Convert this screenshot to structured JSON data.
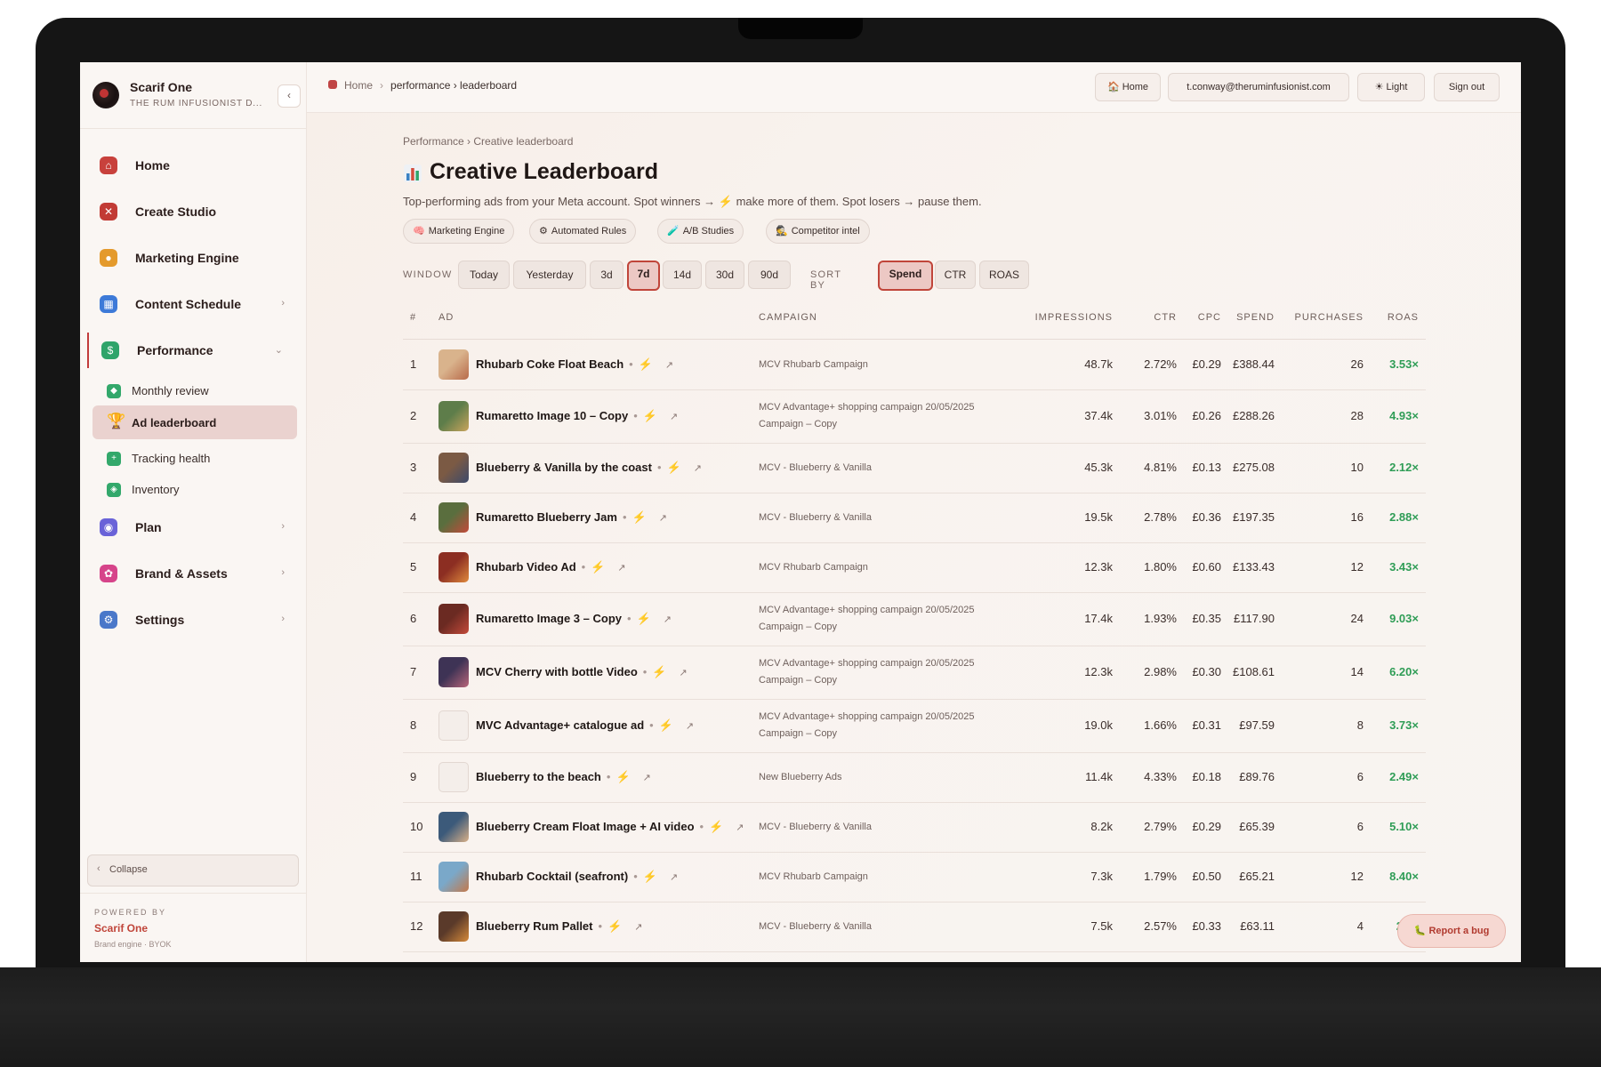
{
  "brand": {
    "name": "Scarif One",
    "subtitle": "THE RUM INFUSIONIST D..."
  },
  "nav": [
    {
      "label": "Home",
      "icon": "home-icon",
      "color": "#c8413c"
    },
    {
      "label": "Create Studio",
      "icon": "tools-icon",
      "color": "#c23b35"
    },
    {
      "label": "Marketing Engine",
      "icon": "brain-icon",
      "color": "#e49a2c"
    },
    {
      "label": "Content Schedule",
      "icon": "calendar-icon",
      "color": "#3d7ad8"
    },
    {
      "label": "Performance",
      "icon": "chart-icon",
      "color": "#2fa46a"
    }
  ],
  "performance_sub": [
    {
      "label": "Monthly review",
      "icon": "review-icon",
      "color": "#33a86b"
    },
    {
      "label": "Ad leaderboard",
      "icon": "trophy-icon",
      "color": "#d9a22b"
    },
    {
      "label": "Tracking health",
      "icon": "health-icon",
      "color": "#33a86b"
    },
    {
      "label": "Inventory",
      "icon": "box-icon",
      "color": "#33a86b"
    }
  ],
  "nav_more": [
    {
      "label": "Plan",
      "icon": "plan-icon",
      "color": "#6a63d8"
    },
    {
      "label": "Brand & Assets",
      "icon": "palette-icon",
      "color": "#d6448a"
    },
    {
      "label": "Settings",
      "icon": "gear-icon",
      "color": "#4a78c9"
    }
  ],
  "collapse_label": "Collapse",
  "powered": {
    "kicker": "POWERED BY",
    "name": "Scarif One",
    "sub": "Brand engine · BYOK"
  },
  "topbar": {
    "crumb_home": "Home",
    "crumb_path": "performance › leaderboard",
    "home_btn": "Home",
    "email": "t.conway@theruminfusionist.com",
    "theme_btn": "Light",
    "signout_btn": "Sign out"
  },
  "page": {
    "crumb": "Performance › Creative leaderboard",
    "title": "Creative Leaderboard",
    "description": "Top-performing ads from your Meta account. Spot winners → ⚡ make more of them. Spot losers → pause them."
  },
  "chips": [
    "Marketing Engine",
    "Automated Rules",
    "A/B Studies",
    "Competitor intel"
  ],
  "window_label": "WINDOW",
  "window_options": [
    "Today",
    "Yesterday",
    "3d",
    "7d",
    "14d",
    "30d",
    "90d"
  ],
  "window_selected": "7d",
  "sort_label": "SORT BY",
  "sort_options": [
    "Spend",
    "CTR",
    "ROAS"
  ],
  "sort_selected": "Spend",
  "columns": [
    "#",
    "AD",
    "CAMPAIGN",
    "IMPRESSIONS",
    "CTR",
    "CPC",
    "SPEND",
    "PURCHASES",
    "ROAS"
  ],
  "rows": [
    {
      "rank": "1",
      "ad": "Rhubarb Coke Float Beach",
      "campaign": "MCV Rhubarb Campaign",
      "impressions": "48.7k",
      "ctr": "2.72%",
      "cpc": "£0.29",
      "spend": "£388.44",
      "purchases": "26",
      "roas": "3.53×"
    },
    {
      "rank": "2",
      "ad": "Rumaretto Image 10 – Copy",
      "campaign": "MCV Advantage+ shopping campaign 20/05/2025 Campaign – Copy",
      "impressions": "37.4k",
      "ctr": "3.01%",
      "cpc": "£0.26",
      "spend": "£288.26",
      "purchases": "28",
      "roas": "4.93×"
    },
    {
      "rank": "3",
      "ad": "Blueberry & Vanilla by the coast",
      "campaign": "MCV - Blueberry & Vanilla",
      "impressions": "45.3k",
      "ctr": "4.81%",
      "cpc": "£0.13",
      "spend": "£275.08",
      "purchases": "10",
      "roas": "2.12×"
    },
    {
      "rank": "4",
      "ad": "Rumaretto Blueberry Jam",
      "campaign": "MCV - Blueberry & Vanilla",
      "impressions": "19.5k",
      "ctr": "2.78%",
      "cpc": "£0.36",
      "spend": "£197.35",
      "purchases": "16",
      "roas": "2.88×"
    },
    {
      "rank": "5",
      "ad": "Rhubarb Video Ad",
      "campaign": "MCV Rhubarb Campaign",
      "impressions": "12.3k",
      "ctr": "1.80%",
      "cpc": "£0.60",
      "spend": "£133.43",
      "purchases": "12",
      "roas": "3.43×"
    },
    {
      "rank": "6",
      "ad": "Rumaretto Image 3 – Copy",
      "campaign": "MCV Advantage+ shopping campaign 20/05/2025 Campaign – Copy",
      "impressions": "17.4k",
      "ctr": "1.93%",
      "cpc": "£0.35",
      "spend": "£117.90",
      "purchases": "24",
      "roas": "9.03×"
    },
    {
      "rank": "7",
      "ad": "MCV Cherry with bottle Video",
      "campaign": "MCV Advantage+ shopping campaign 20/05/2025 Campaign – Copy",
      "impressions": "12.3k",
      "ctr": "2.98%",
      "cpc": "£0.30",
      "spend": "£108.61",
      "purchases": "14",
      "roas": "6.20×"
    },
    {
      "rank": "8",
      "ad": "MVC Advantage+ catalogue ad",
      "campaign": "MCV Advantage+ shopping campaign 20/05/2025 Campaign – Copy",
      "impressions": "19.0k",
      "ctr": "1.66%",
      "cpc": "£0.31",
      "spend": "£97.59",
      "purchases": "8",
      "roas": "3.73×"
    },
    {
      "rank": "9",
      "ad": "Blueberry to the beach",
      "campaign": "New Blueberry Ads",
      "impressions": "11.4k",
      "ctr": "4.33%",
      "cpc": "£0.18",
      "spend": "£89.76",
      "purchases": "6",
      "roas": "2.49×"
    },
    {
      "rank": "10",
      "ad": "Blueberry Cream Float Image + AI video",
      "campaign": "MCV - Blueberry & Vanilla",
      "impressions": "8.2k",
      "ctr": "2.79%",
      "cpc": "£0.29",
      "spend": "£65.39",
      "purchases": "6",
      "roas": "5.10×"
    },
    {
      "rank": "11",
      "ad": "Rhubarb Cocktail (seafront)",
      "campaign": "MCV Rhubarb Campaign",
      "impressions": "7.3k",
      "ctr": "1.79%",
      "cpc": "£0.50",
      "spend": "£65.21",
      "purchases": "12",
      "roas": "8.40×"
    },
    {
      "rank": "12",
      "ad": "Blueberry Rum Pallet",
      "campaign": "MCV - Blueberry & Vanilla",
      "impressions": "7.5k",
      "ctr": "2.57%",
      "cpc": "£0.33",
      "spend": "£63.11",
      "purchases": "4",
      "roas": "2.__"
    }
  ],
  "report_bug": "Report a bug",
  "colors": {
    "accent": "#c0453a",
    "roas_green": "#2f9d56",
    "selected_bg": "#ead2cf"
  }
}
